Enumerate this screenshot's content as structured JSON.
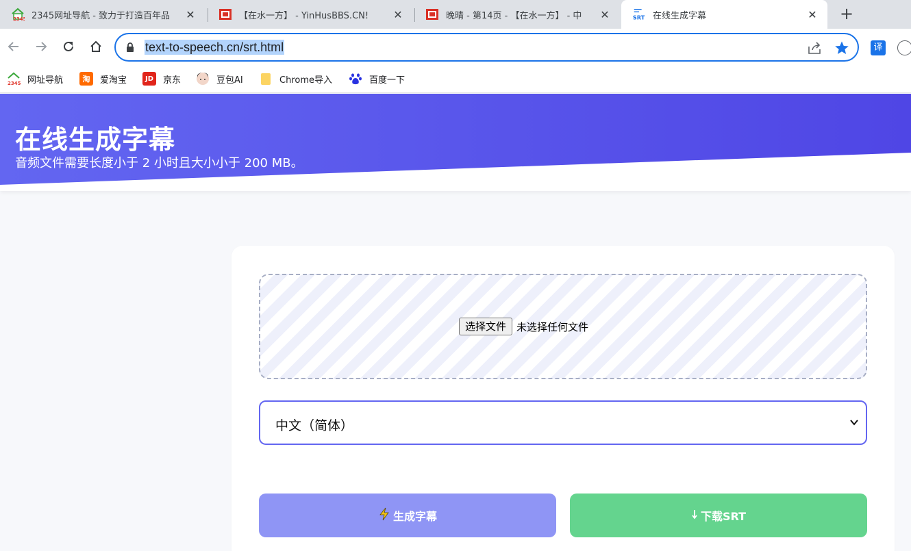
{
  "browser": {
    "tabs": [
      {
        "title": "2345网址导航 - 致力于打造百年品",
        "favicon": "house-icon",
        "active": false
      },
      {
        "title": "【在水一方】 - YinHusBBS.CN!",
        "favicon": "red-window-icon",
        "active": false
      },
      {
        "title": "晚晴 - 第14页 - 【在水一方】 - 中",
        "favicon": "red-window-icon",
        "active": false
      },
      {
        "title": "在线生成字幕",
        "favicon": "srt-icon",
        "active": true
      }
    ],
    "new_tab_label": "+",
    "close_label": "✕",
    "url": "text-to-speech.cn/srt.html",
    "translate_ext_label": "译",
    "accent_color": "#1a73e8"
  },
  "bookmarks": [
    {
      "label": "网址导航",
      "icon": "2345-icon"
    },
    {
      "label": "爱淘宝",
      "icon": "taobao-icon",
      "icon_text": "淘"
    },
    {
      "label": "京东",
      "icon": "jd-icon",
      "icon_text": "JD"
    },
    {
      "label": "豆包AI",
      "icon": "doubao-avatar-icon"
    },
    {
      "label": "Chrome导入",
      "icon": "folder-icon"
    },
    {
      "label": "百度一下",
      "icon": "baidu-paw-icon"
    }
  ],
  "page": {
    "title": "在线生成字幕",
    "subtitle": "音频文件需要长度小于 2 小时且大小小于 200 MB。",
    "file_button": "选择文件",
    "file_status": "未选择任何文件",
    "language_selected": "中文（简体）",
    "generate_label": "生成字幕",
    "generate_icon": "lightning-icon",
    "download_label": "下载SRT",
    "download_icon": "down-arrow-icon",
    "colors": {
      "header_gradient_start": "#6366f1",
      "header_gradient_end": "#4f46e5",
      "generate_button": "#8f95f5",
      "download_button": "#64d48e",
      "select_border": "#6366f1"
    }
  }
}
